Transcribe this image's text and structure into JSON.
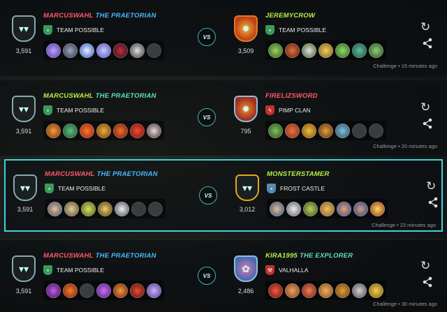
{
  "colors": {
    "accent": "#3fd4d8",
    "name_red": "#ff5a6a",
    "name_green": "#b8f04a",
    "title_blue": "#4bb8ff",
    "title_green": "#5fe0c0"
  },
  "battles": [
    {
      "left": {
        "name": "MARCUSWAHL",
        "title": "THE PRAETORIAN",
        "guild": "TEAM POSSIBLE",
        "rating": "3,591"
      },
      "vs": "VS",
      "right": {
        "name": "JEREMYCROW",
        "title": "",
        "guild": "TEAM POSSIBLE",
        "rating": "3,509"
      },
      "meta": "Challenge • 15 minutes ago"
    },
    {
      "left": {
        "name": "MARCUSWAHL",
        "title": "THE PRAETORIAN",
        "guild": "TEAM POSSIBLE",
        "rating": "3,591"
      },
      "vs": "VS",
      "right": {
        "name": "FIRELIZSWORD",
        "title": "",
        "guild": "PIMP CLAN",
        "rating": "795"
      },
      "meta": "Challenge • 20 minutes ago"
    },
    {
      "left": {
        "name": "MARCUSWAHL",
        "title": "THE PRAETORIAN",
        "guild": "TEAM POSSIBLE",
        "rating": "3,591"
      },
      "vs": "VS",
      "right": {
        "name": "MONSTERSTAMER",
        "title": "",
        "guild": "FROST CASTLE",
        "rating": "3,012"
      },
      "meta": "Challenge • 23 minutes ago"
    },
    {
      "left": {
        "name": "MARCUSWAHL",
        "title": "THE PRAETORIAN",
        "guild": "TEAM POSSIBLE",
        "rating": "3,591"
      },
      "vs": "VS",
      "right": {
        "name": "KIRA1995",
        "title": "THE EXPLORER",
        "guild": "VALHALLA",
        "rating": "2,486"
      },
      "meta": "Challenge • 30 minutes ago"
    }
  ]
}
